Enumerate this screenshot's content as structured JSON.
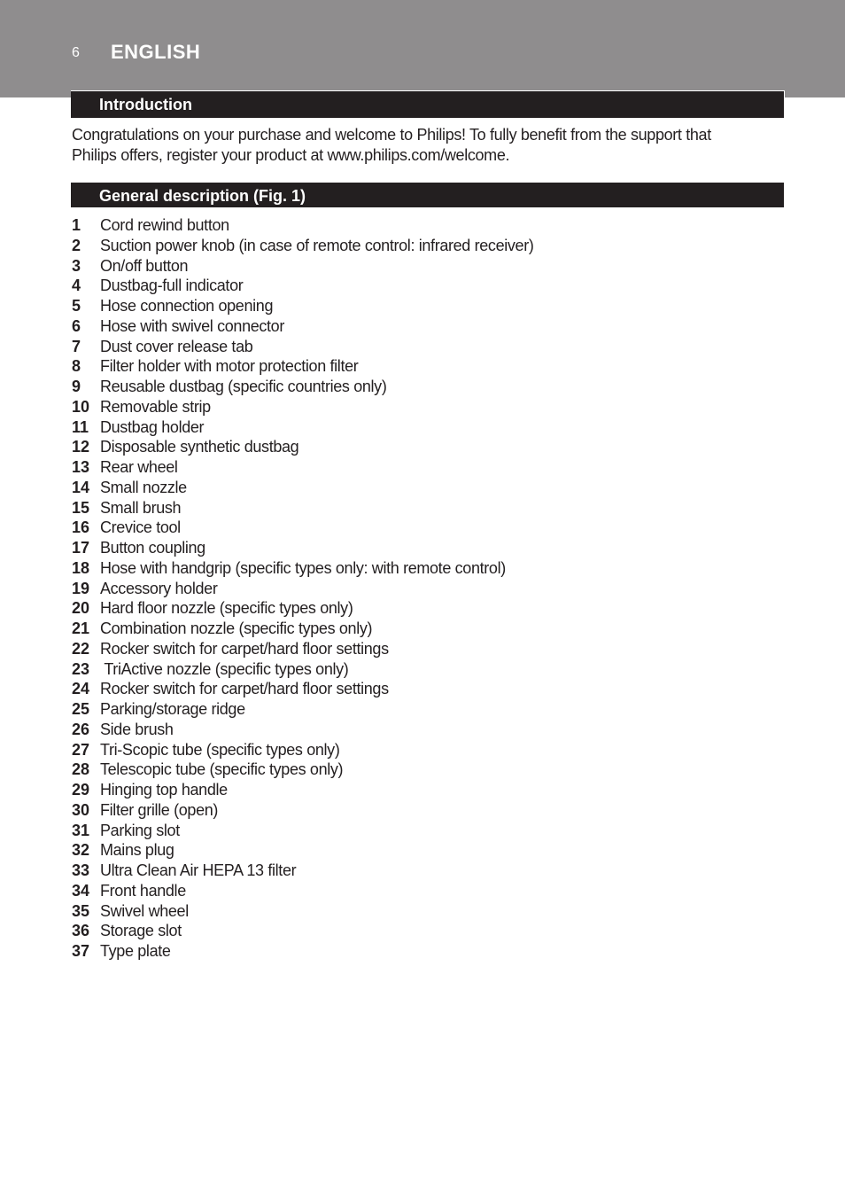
{
  "header": {
    "page_number": "6",
    "language": "ENGLISH"
  },
  "sections": {
    "introduction": {
      "title": "Introduction",
      "body_line1": "Congratulations on your purchase and welcome to Philips! To fully benefit from the support that",
      "body_line2": "Philips offers, register your product at www.philips.com/welcome."
    },
    "general_description": {
      "title": "General description (Fig. 1)",
      "items": [
        {
          "num": "1",
          "text": "Cord rewind button"
        },
        {
          "num": "2",
          "text": "Suction power knob (in case of remote control: infrared receiver)"
        },
        {
          "num": "3",
          "text": "On/off button"
        },
        {
          "num": "4",
          "text": "Dustbag-full indicator"
        },
        {
          "num": "5",
          "text": "Hose connection opening"
        },
        {
          "num": "6",
          "text": "Hose with swivel connector"
        },
        {
          "num": "7",
          "text": "Dust cover release tab"
        },
        {
          "num": "8",
          "text": "Filter holder with motor protection filter"
        },
        {
          "num": "9",
          "text": "Reusable dustbag (specific countries only)"
        },
        {
          "num": "10",
          "text": "Removable strip"
        },
        {
          "num": "11",
          "text": "Dustbag holder"
        },
        {
          "num": "12",
          "text": "Disposable synthetic dustbag"
        },
        {
          "num": "13",
          "text": "Rear wheel"
        },
        {
          "num": "14",
          "text": "Small nozzle"
        },
        {
          "num": "15",
          "text": "Small brush"
        },
        {
          "num": "16",
          "text": "Crevice tool"
        },
        {
          "num": "17",
          "text": "Button coupling"
        },
        {
          "num": "18",
          "text": "Hose with handgrip (specific types only: with remote control)"
        },
        {
          "num": "19",
          "text": "Accessory holder"
        },
        {
          "num": "20",
          "text": "Hard floor nozzle (specific types only)"
        },
        {
          "num": "21",
          "text": "Combination nozzle (specific types only)"
        },
        {
          "num": "22",
          "text": "Rocker switch for carpet/hard floor settings"
        },
        {
          "num": "23",
          "text": " TriActive nozzle (specific types only)"
        },
        {
          "num": "24",
          "text": "Rocker switch for carpet/hard floor settings"
        },
        {
          "num": "25",
          "text": "Parking/storage ridge"
        },
        {
          "num": "26",
          "text": "Side brush"
        },
        {
          "num": "27",
          "text": "Tri-Scopic tube (specific types only)"
        },
        {
          "num": "28",
          "text": "Telescopic tube (specific types only)"
        },
        {
          "num": "29",
          "text": "Hinging top handle"
        },
        {
          "num": "30",
          "text": "Filter grille (open)"
        },
        {
          "num": "31",
          "text": "Parking slot"
        },
        {
          "num": "32",
          "text": "Mains plug"
        },
        {
          "num": "33",
          "text": "Ultra Clean Air HEPA 13 filter"
        },
        {
          "num": "34",
          "text": "Front handle"
        },
        {
          "num": "35",
          "text": "Swivel wheel"
        },
        {
          "num": "36",
          "text": "Storage slot"
        },
        {
          "num": "37",
          "text": "Type plate"
        }
      ]
    }
  },
  "colors": {
    "header_band": "#8f8d8e",
    "section_bar": "#231f20",
    "text": "#231f20"
  }
}
